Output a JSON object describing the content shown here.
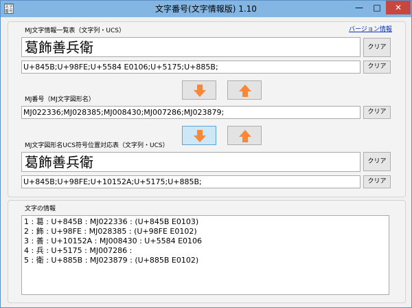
{
  "window": {
    "title": "文字番号(文字情報版) 1.10",
    "icon_text": "文字番号",
    "minimize_glyph": "—",
    "maximize_glyph": "□",
    "close_glyph": "✕"
  },
  "section1": {
    "label": "MJ文字情報一覧表（文字列・UCS）",
    "version_link": "バージョン情報",
    "text_value": "葛飾善兵衛",
    "ucs_value": "U+845B;U+98FE;U+5584 E0106;U+5175;U+885B;",
    "clear_label": "クリア"
  },
  "section2": {
    "label": "MJ番号（MJ文字図形名）",
    "value": "MJ022336;MJ028385;MJ008430;MJ007286;MJ023879;",
    "clear_label": "クリア"
  },
  "section3": {
    "label": "MJ文字図形名UCS符号位置対応表（文字列・UCS）",
    "text_value": "葛飾善兵衛",
    "ucs_value": "U+845B;U+98FE;U+10152A;U+5175;U+885B;",
    "clear_label": "クリア"
  },
  "arrows": {
    "down_icon": "down-arrow-icon",
    "up_icon": "up-arrow-icon",
    "color": "#f7883a"
  },
  "info": {
    "label": "文字の情報",
    "lines": [
      "1 : 葛 : U+845B : MJ022336 : (U+845B E0103)",
      "2 : 飾 : U+98FE : MJ028385 : (U+98FE E0102)",
      "3 : 善 : U+10152A : MJ008430 : U+5584 E0106",
      "4 : 兵 : U+5175 : MJ007286 :",
      "5 : 衛 : U+885B : MJ023879 : (U+885B E0102)"
    ]
  }
}
